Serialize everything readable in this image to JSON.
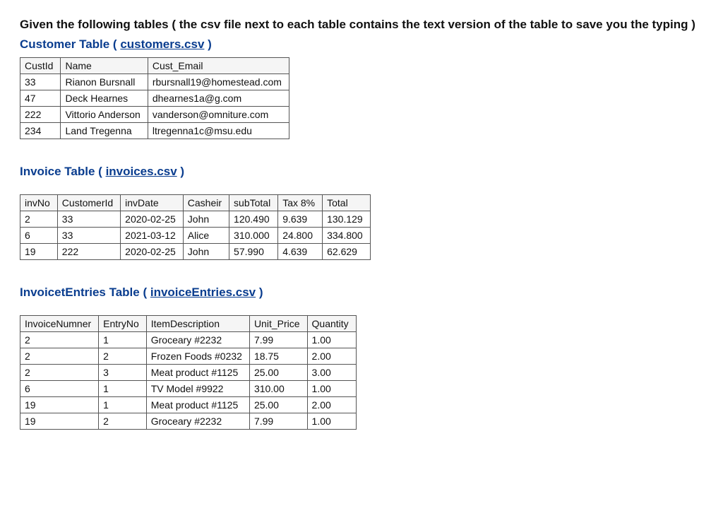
{
  "intro": "Given the following tables ( the csv file next to each table contains the text version of the table to save you the typing )",
  "sections": {
    "customer": {
      "title_prefix": "Customer Table ( ",
      "link_text": "customers.csv",
      "title_suffix": "  )",
      "headers": [
        "CustId",
        "Name",
        "Cust_Email"
      ],
      "rows": [
        [
          "33",
          "Rianon Bursnall",
          "rbursnall19@homestead.com"
        ],
        [
          "47",
          "Deck Hearnes",
          "dhearnes1a@g.com"
        ],
        [
          "222",
          "Vittorio Anderson",
          "vanderson@omniture.com"
        ],
        [
          "234",
          "Land Tregenna",
          "ltregenna1c@msu.edu"
        ]
      ]
    },
    "invoice": {
      "title_prefix": "Invoice Table ( ",
      "link_text": "invoices.csv",
      "title_suffix": " )",
      "headers": [
        "invNo",
        "CustomerId",
        "invDate",
        "Casheir",
        "subTotal",
        "Tax 8%",
        "Total"
      ],
      "rows": [
        [
          "2",
          "33",
          "2020-02-25",
          "John",
          "120.490",
          "9.639",
          "130.129"
        ],
        [
          "6",
          "33",
          "2021-03-12",
          "Alice",
          "310.000",
          "24.800",
          "334.800"
        ],
        [
          "19",
          "222",
          "2020-02-25",
          "John",
          "57.990",
          "4.639",
          "62.629"
        ]
      ]
    },
    "entries": {
      "title_prefix": "InvoicetEntries Table ( ",
      "link_text": "invoiceEntries.csv",
      "title_suffix": " )",
      "headers": [
        "InvoiceNumner",
        "EntryNo",
        "ItemDescription",
        "Unit_Price",
        "Quantity"
      ],
      "rows": [
        [
          "2",
          "1",
          "Groceary  #2232",
          "7.99",
          "1.00"
        ],
        [
          "2",
          "2",
          "Frozen Foods  #0232",
          "18.75",
          "2.00"
        ],
        [
          "2",
          "3",
          "Meat product #1125",
          "25.00",
          "3.00"
        ],
        [
          "6",
          "1",
          "TV Model #9922",
          "310.00",
          "1.00"
        ],
        [
          "19",
          "1",
          "Meat product #1125",
          "25.00",
          "2.00"
        ],
        [
          "19",
          "2",
          "Groceary #2232",
          "7.99",
          "1.00"
        ]
      ]
    }
  }
}
